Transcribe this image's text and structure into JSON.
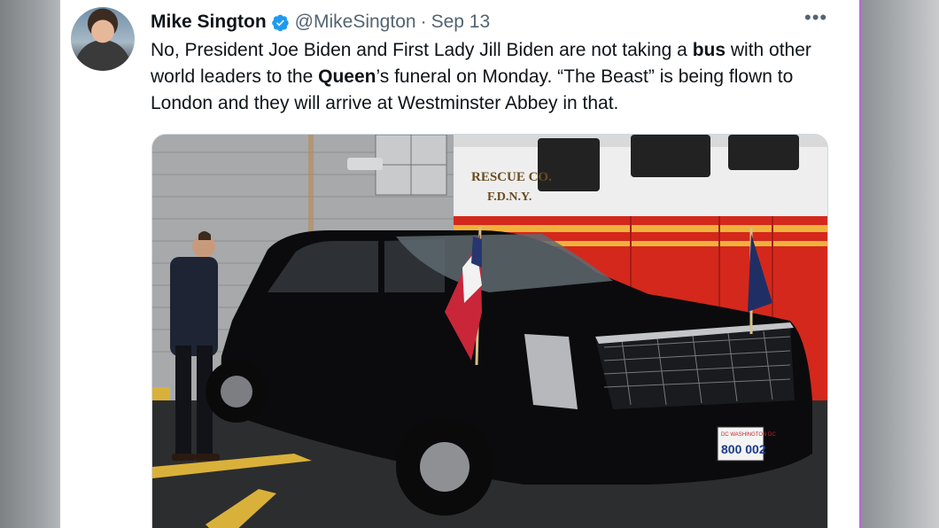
{
  "tweet": {
    "author_name": "Mike Sington",
    "handle": "@MikeSington",
    "separator": "·",
    "date": "Sep 13",
    "more_label": "•••",
    "text_parts": [
      {
        "t": "No, President Joe Biden and First Lady Jill Biden are not taking a ",
        "b": false
      },
      {
        "t": "bus",
        "b": true
      },
      {
        "t": " with other world leaders to the ",
        "b": false
      },
      {
        "t": "Queen",
        "b": true
      },
      {
        "t": "’s funeral on Monday. “The Beast” is being flown to London and they will arrive at Westminster Abbey in that.",
        "b": false
      }
    ],
    "media": {
      "truck_text_line1": "RESCUE CO.",
      "truck_text_line2": "F.D.N.Y.",
      "plate_top": "DC WASHINGTON DC",
      "plate_number": "800 002"
    }
  },
  "colors": {
    "verified": "#1d9bf0",
    "text": "#0f1419",
    "secondary": "#536471",
    "truck_red": "#d4281c",
    "car_black": "#0b0b0d"
  }
}
